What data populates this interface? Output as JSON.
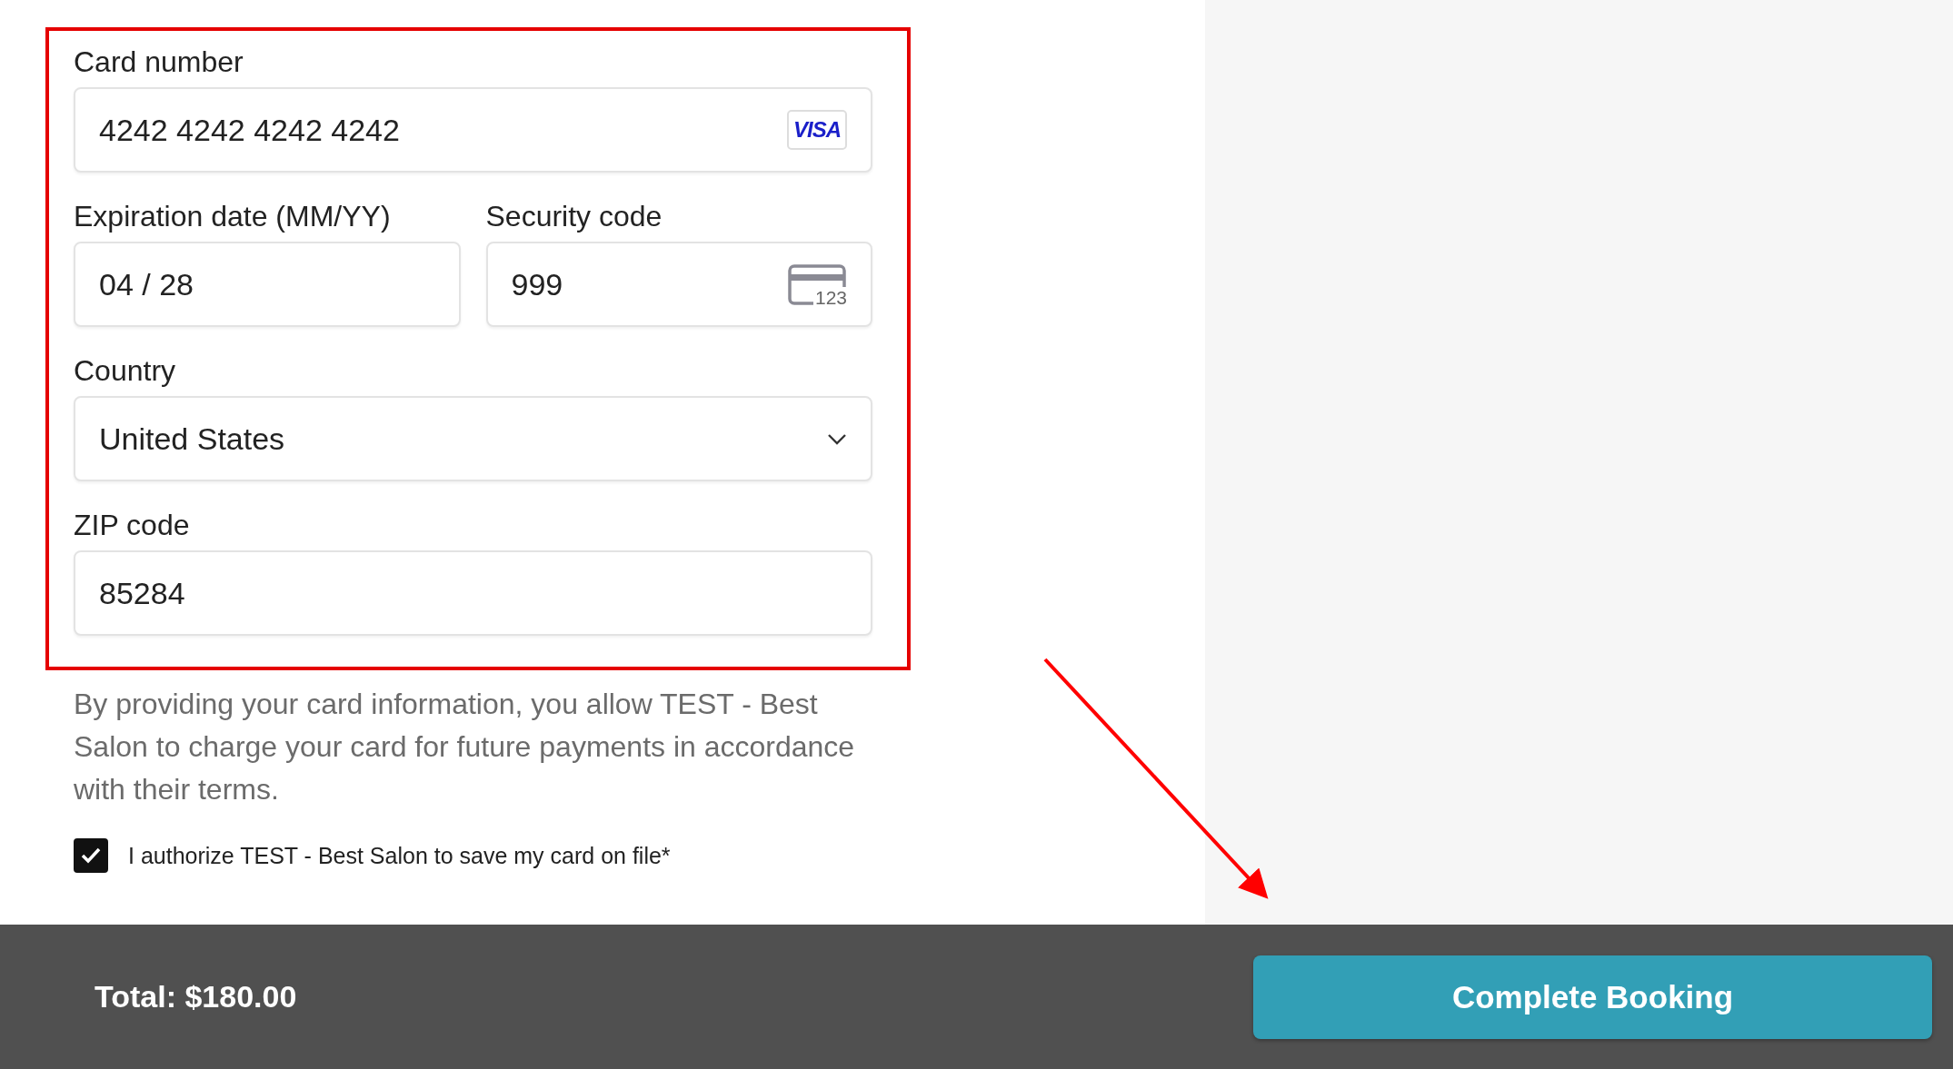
{
  "payment_form": {
    "rows": [
      {
        "fields": [
          {
            "label": "Card number",
            "value": "4242 4242 4242 4242",
            "kind": "card"
          }
        ]
      },
      {
        "fields": [
          {
            "label": "Expiration date (MM/YY)",
            "value": "04 / 28",
            "kind": "text"
          },
          {
            "label": "Security code",
            "value": "999",
            "kind": "cvc"
          }
        ]
      },
      {
        "fields": [
          {
            "label": "Country",
            "value": "United States",
            "kind": "select"
          }
        ]
      },
      {
        "fields": [
          {
            "label": "ZIP code",
            "value": "85284",
            "kind": "text"
          }
        ]
      }
    ],
    "card_brand": "VISA",
    "cvc_hint": "123"
  },
  "disclaimer": "By providing your card information, you allow TEST - Best Salon to charge your card for future payments in accordance with their terms.",
  "consent": {
    "label": "I authorize TEST - Best Salon to save my card on file*",
    "checked": true
  },
  "footer": {
    "total": "Total: $180.00",
    "button": "Complete Booking"
  }
}
